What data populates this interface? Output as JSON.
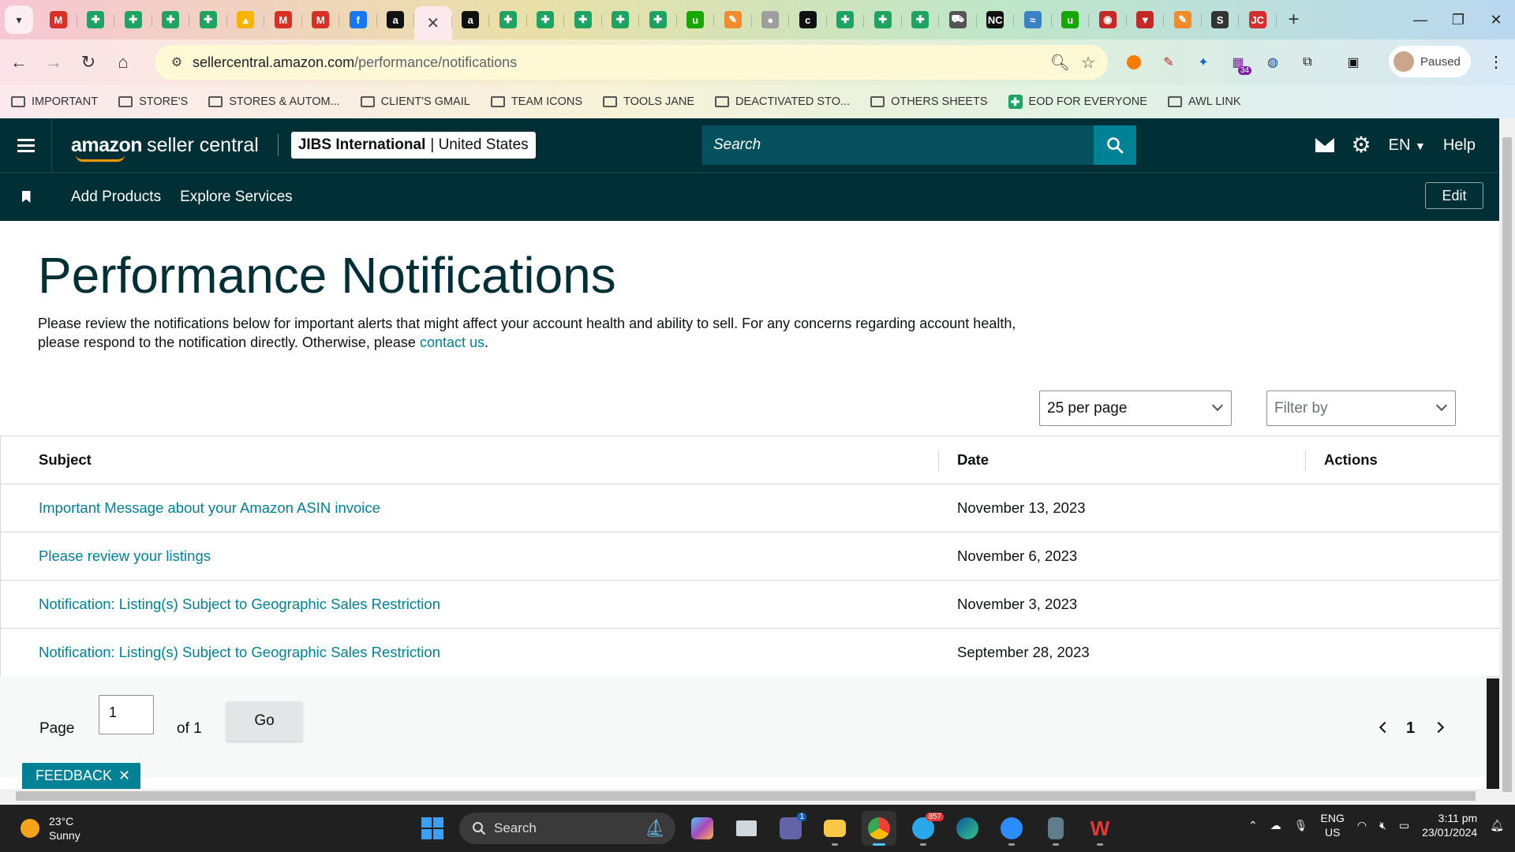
{
  "browser": {
    "tabs": [
      {
        "icon": "gmail-icon",
        "glyph": "M",
        "color": "#d93025"
      },
      {
        "icon": "sheets-icon",
        "glyph": "✚",
        "color": "#1ea362"
      },
      {
        "icon": "sheets-icon",
        "glyph": "✚",
        "color": "#1ea362"
      },
      {
        "icon": "sheets-icon",
        "glyph": "✚",
        "color": "#1ea362"
      },
      {
        "icon": "sheets-icon",
        "glyph": "✚",
        "color": "#1ea362"
      },
      {
        "icon": "drive-icon",
        "glyph": "▲",
        "color": "#f4b400"
      },
      {
        "icon": "gmail-icon",
        "glyph": "M",
        "color": "#d93025"
      },
      {
        "icon": "gmail-icon",
        "glyph": "M",
        "color": "#d93025"
      },
      {
        "icon": "facebook-icon",
        "glyph": "f",
        "color": "#1877f2"
      },
      {
        "icon": "amazon-icon",
        "glyph": "a",
        "color": "#111111"
      },
      {
        "icon": "close-icon",
        "glyph": "✕",
        "color": "#444444",
        "active": true
      },
      {
        "icon": "amazon-icon",
        "glyph": "a",
        "color": "#111111"
      },
      {
        "icon": "sheets-icon",
        "glyph": "✚",
        "color": "#1ea362"
      },
      {
        "icon": "sheets-icon",
        "glyph": "✚",
        "color": "#1ea362"
      },
      {
        "icon": "sheets-icon",
        "glyph": "✚",
        "color": "#1ea362"
      },
      {
        "icon": "sheets-icon",
        "glyph": "✚",
        "color": "#1ea362"
      },
      {
        "icon": "sheets-icon",
        "glyph": "✚",
        "color": "#1ea362"
      },
      {
        "icon": "upwork-icon",
        "glyph": "u",
        "color": "#14a800"
      },
      {
        "icon": "pencil-app-icon",
        "glyph": "✎",
        "color": "#f28b2b"
      },
      {
        "icon": "link-icon",
        "glyph": "●",
        "color": "#9e9e9e"
      },
      {
        "icon": "c-icon",
        "glyph": "c",
        "color": "#111111"
      },
      {
        "icon": "sheets-icon",
        "glyph": "✚",
        "color": "#1ea362"
      },
      {
        "icon": "sheets-icon",
        "glyph": "✚",
        "color": "#1ea362"
      },
      {
        "icon": "sheets-icon",
        "glyph": "✚",
        "color": "#1ea362"
      },
      {
        "icon": "car-icon",
        "glyph": "⛟",
        "color": "#555555"
      },
      {
        "icon": "nc-icon",
        "glyph": "NC",
        "color": "#111111"
      },
      {
        "icon": "sysco-icon",
        "glyph": "≈",
        "color": "#3b82c4"
      },
      {
        "icon": "upwork-icon",
        "glyph": "u",
        "color": "#14a800"
      },
      {
        "icon": "badge-icon",
        "glyph": "◉",
        "color": "#c62828"
      },
      {
        "icon": "shield-icon",
        "glyph": "▼",
        "color": "#c62828"
      },
      {
        "icon": "pencil-app-icon",
        "glyph": "✎",
        "color": "#f28b2b"
      },
      {
        "icon": "stan-icon",
        "glyph": "S",
        "color": "#333333"
      },
      {
        "icon": "jc-icon",
        "glyph": "JC",
        "color": "#d32f2f"
      }
    ],
    "url_domain": "sellercentral.amazon.com",
    "url_path": "/performance/notifications",
    "profile_status": "Paused",
    "ext_badge": "34",
    "bookmarks": [
      {
        "label": "IMPORTANT",
        "type": "folder"
      },
      {
        "label": "STORE'S",
        "type": "folder"
      },
      {
        "label": "STORES & AUTOM...",
        "type": "folder"
      },
      {
        "label": "CLIENT'S GMAIL",
        "type": "folder"
      },
      {
        "label": "TEAM ICONS",
        "type": "folder"
      },
      {
        "label": "TOOLS JANE",
        "type": "folder"
      },
      {
        "label": "DEACTIVATED STO...",
        "type": "folder"
      },
      {
        "label": "OTHERS SHEETS",
        "type": "folder"
      },
      {
        "label": "EOD FOR EVERYONE",
        "type": "sheet"
      },
      {
        "label": "AWL LINK",
        "type": "folder"
      }
    ]
  },
  "header": {
    "logo_amazon": "amazon",
    "logo_suffix": "seller central",
    "account_name": "JIBS International",
    "account_region": "| United States",
    "search_placeholder": "Search",
    "language": "EN",
    "help": "Help"
  },
  "nav": {
    "links": [
      "Add Products",
      "Explore Services"
    ],
    "edit": "Edit"
  },
  "page": {
    "title": "Performance Notifications",
    "desc_text": "Please review the notifications below for important alerts that might affect your account health and ability to sell. For any concerns regarding account health, please respond to the notification directly. Otherwise, please ",
    "desc_link": "contact us",
    "desc_end": ".",
    "per_page": "25 per page",
    "filter_placeholder": "Filter by"
  },
  "table": {
    "headers": {
      "subject": "Subject",
      "date": "Date",
      "actions": "Actions"
    },
    "rows": [
      {
        "subject": "Important Message about your Amazon ASIN invoice",
        "date": "November 13, 2023"
      },
      {
        "subject": "Please review your listings",
        "date": "November 6, 2023"
      },
      {
        "subject": "Notification: Listing(s) Subject to Geographic Sales Restriction",
        "date": "November 3, 2023"
      },
      {
        "subject": "Notification: Listing(s) Subject to Geographic Sales Restriction",
        "date": "September 28, 2023"
      }
    ]
  },
  "pagination": {
    "page_label": "Page",
    "page_value": "1",
    "of_label": "of 1",
    "go": "Go",
    "current": "1"
  },
  "feedback": {
    "label": "FEEDBACK"
  },
  "taskbar": {
    "temp": "23°C",
    "condition": "Sunny",
    "search": "Search",
    "lang1": "ENG",
    "lang2": "US",
    "time": "3:11 pm",
    "date": "23/01/2024",
    "teams_badge": "1",
    "telegram_badge": "857"
  }
}
